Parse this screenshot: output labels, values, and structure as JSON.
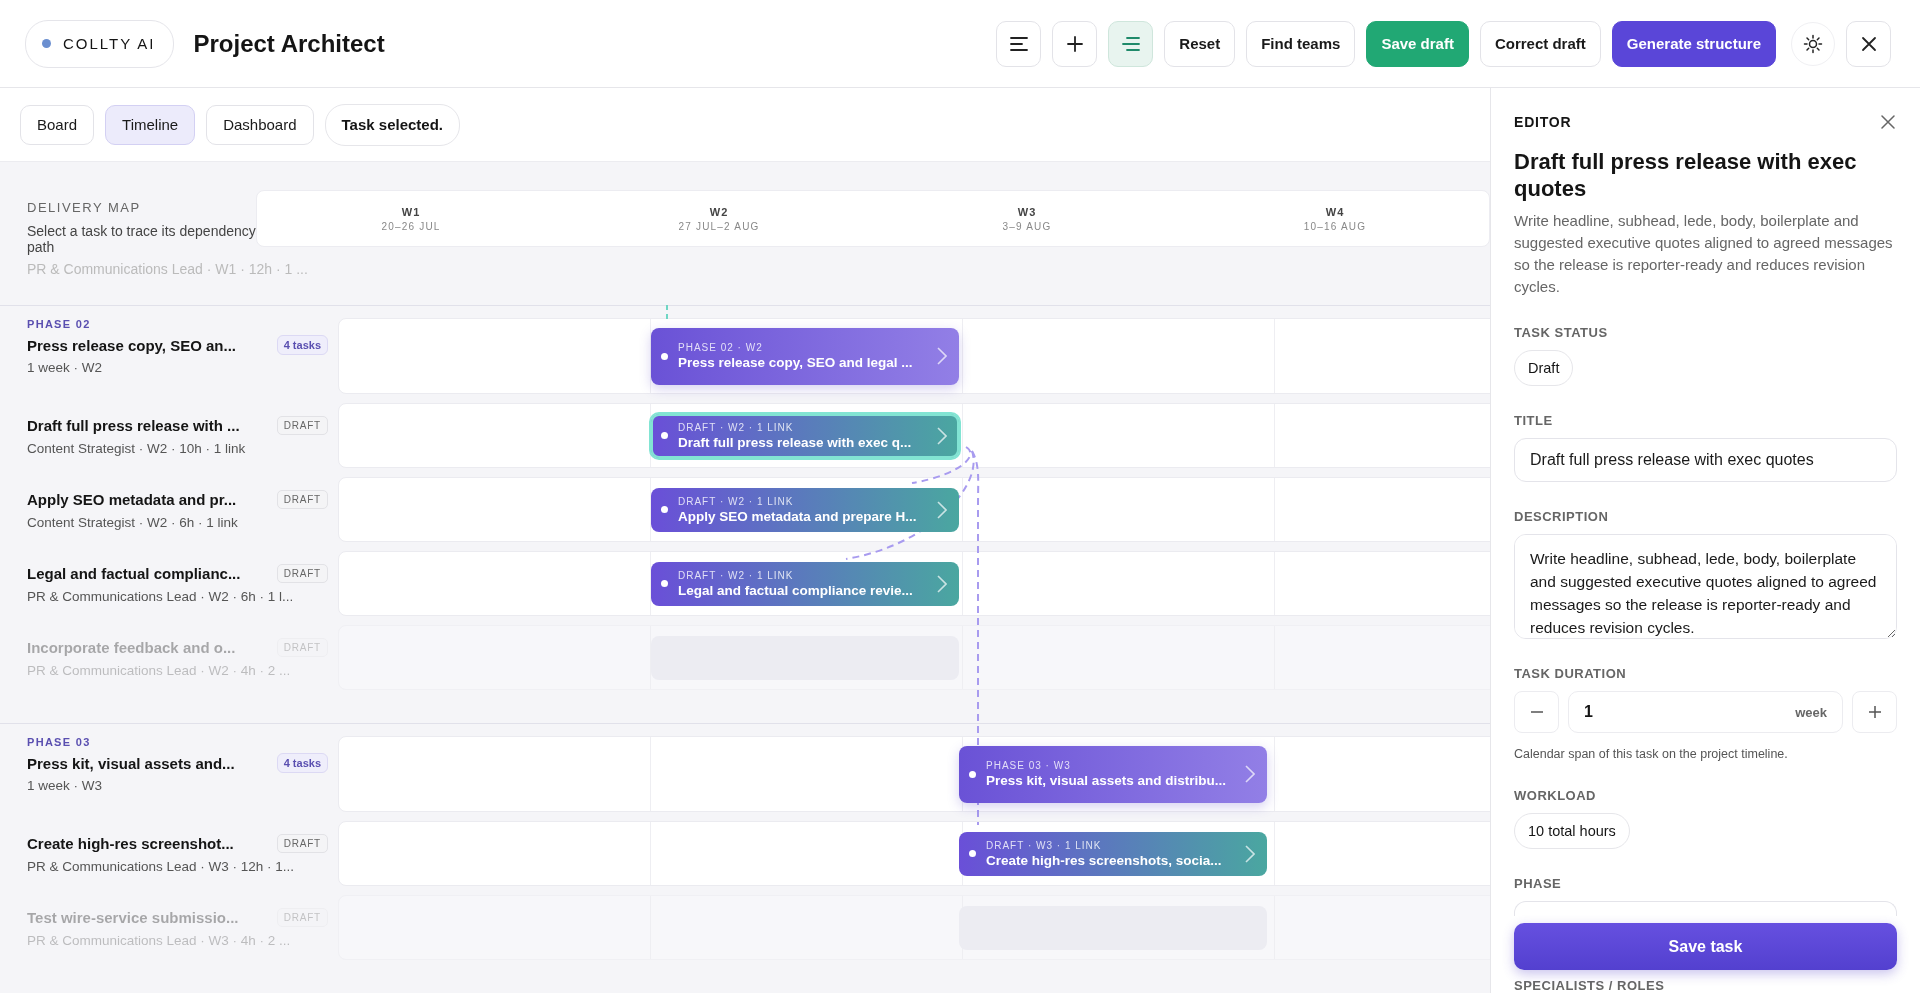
{
  "app": {
    "brand": "COLLTY AI",
    "title": "Project Architect"
  },
  "toolbar": {
    "icon_buttons": [
      {
        "kind": "list",
        "selected": false
      },
      {
        "kind": "add",
        "selected": false
      },
      {
        "kind": "outline",
        "selected": true
      }
    ],
    "buttons": [
      {
        "label": "Reset",
        "kind": "plain"
      },
      {
        "label": "Find teams",
        "kind": "plain"
      },
      {
        "label": "Save draft",
        "kind": "success"
      },
      {
        "label": "Correct draft",
        "kind": "plain"
      },
      {
        "label": "Generate structure",
        "kind": "primary"
      }
    ]
  },
  "view_tabs": [
    {
      "label": "Board",
      "selected": false
    },
    {
      "label": "Timeline",
      "selected": true
    },
    {
      "label": "Dashboard",
      "selected": false
    }
  ],
  "status": "Task selected.",
  "delivery_map": {
    "title": "DELIVERY MAP",
    "subtitle": "Select a task to trace its dependency path",
    "scrolled_meta": "PR & Communications Lead · W1 · 12h · 1 ...",
    "weeks": [
      {
        "label": "W1",
        "dates": "20–26 JUL"
      },
      {
        "label": "W2",
        "dates": "27 JUL–2 AUG"
      },
      {
        "label": "W3",
        "dates": "3–9 AUG"
      },
      {
        "label": "W4",
        "dates": "10–16 AUG"
      }
    ]
  },
  "phases": [
    {
      "label": "PHASE 02",
      "title": "Press release copy, SEO an...",
      "count": "4 tasks",
      "meta": "1 week · W2",
      "bar": {
        "meta": "PHASE 02 · W2",
        "title": "Press release copy, SEO and legal ..."
      },
      "tasks": [
        {
          "title": "Draft full press release with ...",
          "badge": "DRAFT",
          "meta": "Content Strategist · W2 · 10h · 1 link",
          "dimmed": false,
          "selected": true,
          "bar": {
            "meta": "DRAFT · W2 · 1 LINK",
            "title": "Draft full press release with exec q..."
          }
        },
        {
          "title": "Apply SEO metadata and pr...",
          "badge": "DRAFT",
          "meta": "Content Strategist · W2 · 6h · 1 link",
          "dimmed": false,
          "selected": false,
          "bar": {
            "meta": "DRAFT · W2 · 1 LINK",
            "title": "Apply SEO metadata and prepare H..."
          }
        },
        {
          "title": "Legal and factual complianc...",
          "badge": "DRAFT",
          "meta": "PR & Communications Lead · W2 · 6h · 1 l...",
          "dimmed": false,
          "selected": false,
          "bar": {
            "meta": "DRAFT · W2 · 1 LINK",
            "title": "Legal and factual compliance revie..."
          }
        },
        {
          "title": "Incorporate feedback and o...",
          "badge": "DRAFT",
          "meta": "PR & Communications Lead · W2 · 4h · 2 ...",
          "dimmed": true,
          "selected": false
        }
      ]
    },
    {
      "label": "PHASE 03",
      "title": "Press kit, visual assets and...",
      "count": "4 tasks",
      "meta": "1 week · W3",
      "bar": {
        "meta": "PHASE 03 · W3",
        "title": "Press kit, visual assets and distribu..."
      },
      "tasks": [
        {
          "title": "Create high-res screenshot...",
          "badge": "DRAFT",
          "meta": "PR & Communications Lead · W3 · 12h · 1...",
          "dimmed": false,
          "selected": false,
          "bar": {
            "meta": "DRAFT · W3 · 1 LINK",
            "title": "Create high-res screenshots, socia..."
          }
        },
        {
          "title": "Test wire-service submissio...",
          "badge": "DRAFT",
          "meta": "PR & Communications Lead · W3 · 4h · 2 ...",
          "dimmed": true,
          "selected": false
        }
      ]
    }
  ],
  "editor": {
    "heading": "EDITOR",
    "title": "Draft full press release with exec quotes",
    "summary": "Write headline, subhead, lede, body, boilerplate and suggested executive quotes aligned to agreed messages so the release is reporter-ready and reduces revision cycles.",
    "status_label": "TASK STATUS",
    "status_value": "Draft",
    "title_label": "TITLE",
    "title_value": "Draft full press release with exec quotes",
    "description_label": "DESCRIPTION",
    "description_value": "Write headline, subhead, lede, body, boilerplate and suggested executive quotes aligned to agreed messages so the release is reporter-ready and reduces revision cycles.",
    "duration_label": "TASK DURATION",
    "duration_value": "1",
    "duration_unit": "week",
    "duration_hint": "Calendar span of this task on the project timeline.",
    "workload_label": "WORKLOAD",
    "workload_value": "10 total hours",
    "phase_label": "PHASE",
    "specialists_label": "SPECIALISTS / ROLES",
    "save": "Save task"
  }
}
